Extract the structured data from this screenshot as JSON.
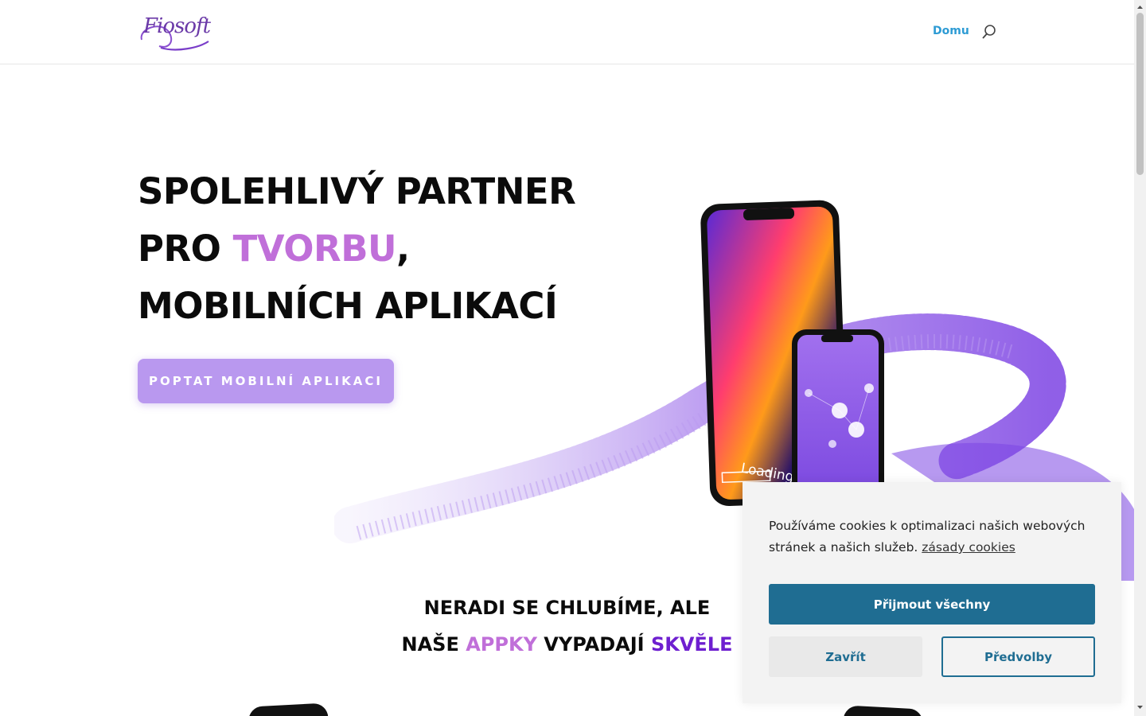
{
  "header": {
    "logo_text": "Fiosoft",
    "nav_home": "Domu",
    "search_icon": "search-icon"
  },
  "hero": {
    "line1": "SPOLEHLIVÝ PARTNER",
    "line2_prefix": "PRO ",
    "line2_accent": "TVORBU",
    "line2_suffix": ",",
    "line3": "MOBILNÍCH APLIKACÍ",
    "cta": "POPTAT MOBILNÍ APLIKACI",
    "phone_loading_text": "Loading."
  },
  "section2": {
    "line1": "NERADI SE CHLUBÍME, ALE",
    "line2_prefix": "NAŠE ",
    "line2_accent1": "APPKY",
    "line2_middle": " VYPADAJÍ ",
    "line2_accent2": "SKVĚLE"
  },
  "cookie": {
    "text": "Používáme cookies k optimalizaci našich webových stránek a našich služeb.",
    "link": "zásady cookies",
    "accept": "Přijmout všechny",
    "close": "Zavřít",
    "preferences": "Předvolby"
  },
  "colors": {
    "accent_pink": "#c06fd9",
    "accent_purple": "#6e1fd0",
    "cta_bg": "#b998ef",
    "nav_link": "#2d9bd4",
    "cookie_button": "#1f6d92"
  }
}
